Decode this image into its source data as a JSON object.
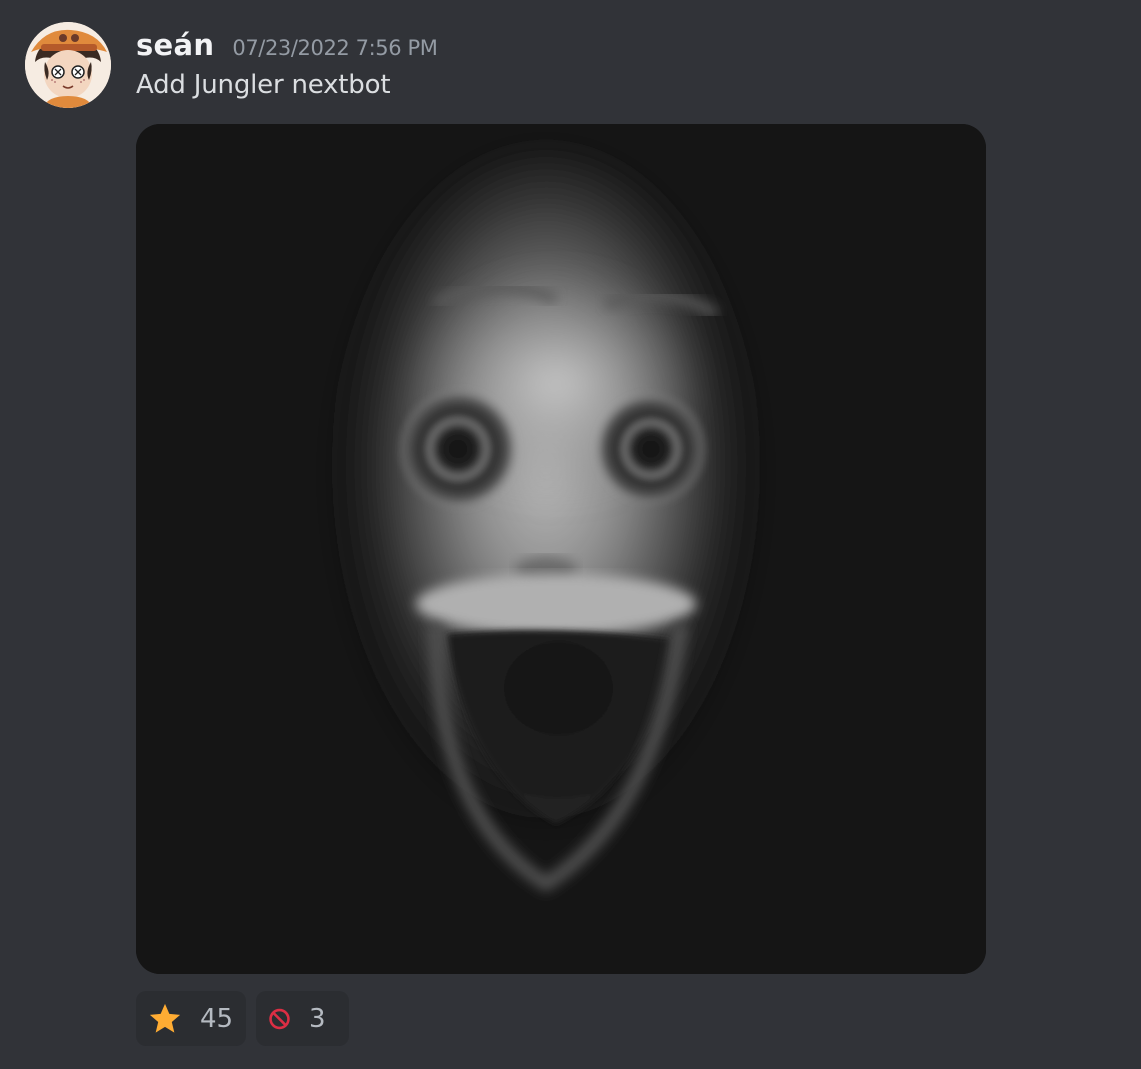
{
  "message": {
    "author": "seán",
    "timestamp": "07/23/2022 7:56 PM",
    "content": "Add Jungler nextbot"
  },
  "reactions": [
    {
      "emoji_icon": "star-emoji",
      "count": "45"
    },
    {
      "emoji_icon": "no-entry-sign-emoji",
      "count": "3"
    }
  ],
  "colors": {
    "background": "#313338",
    "reaction_bg": "#2b2d31",
    "username": "#f2f3f5",
    "timestamp": "#949ba4"
  }
}
